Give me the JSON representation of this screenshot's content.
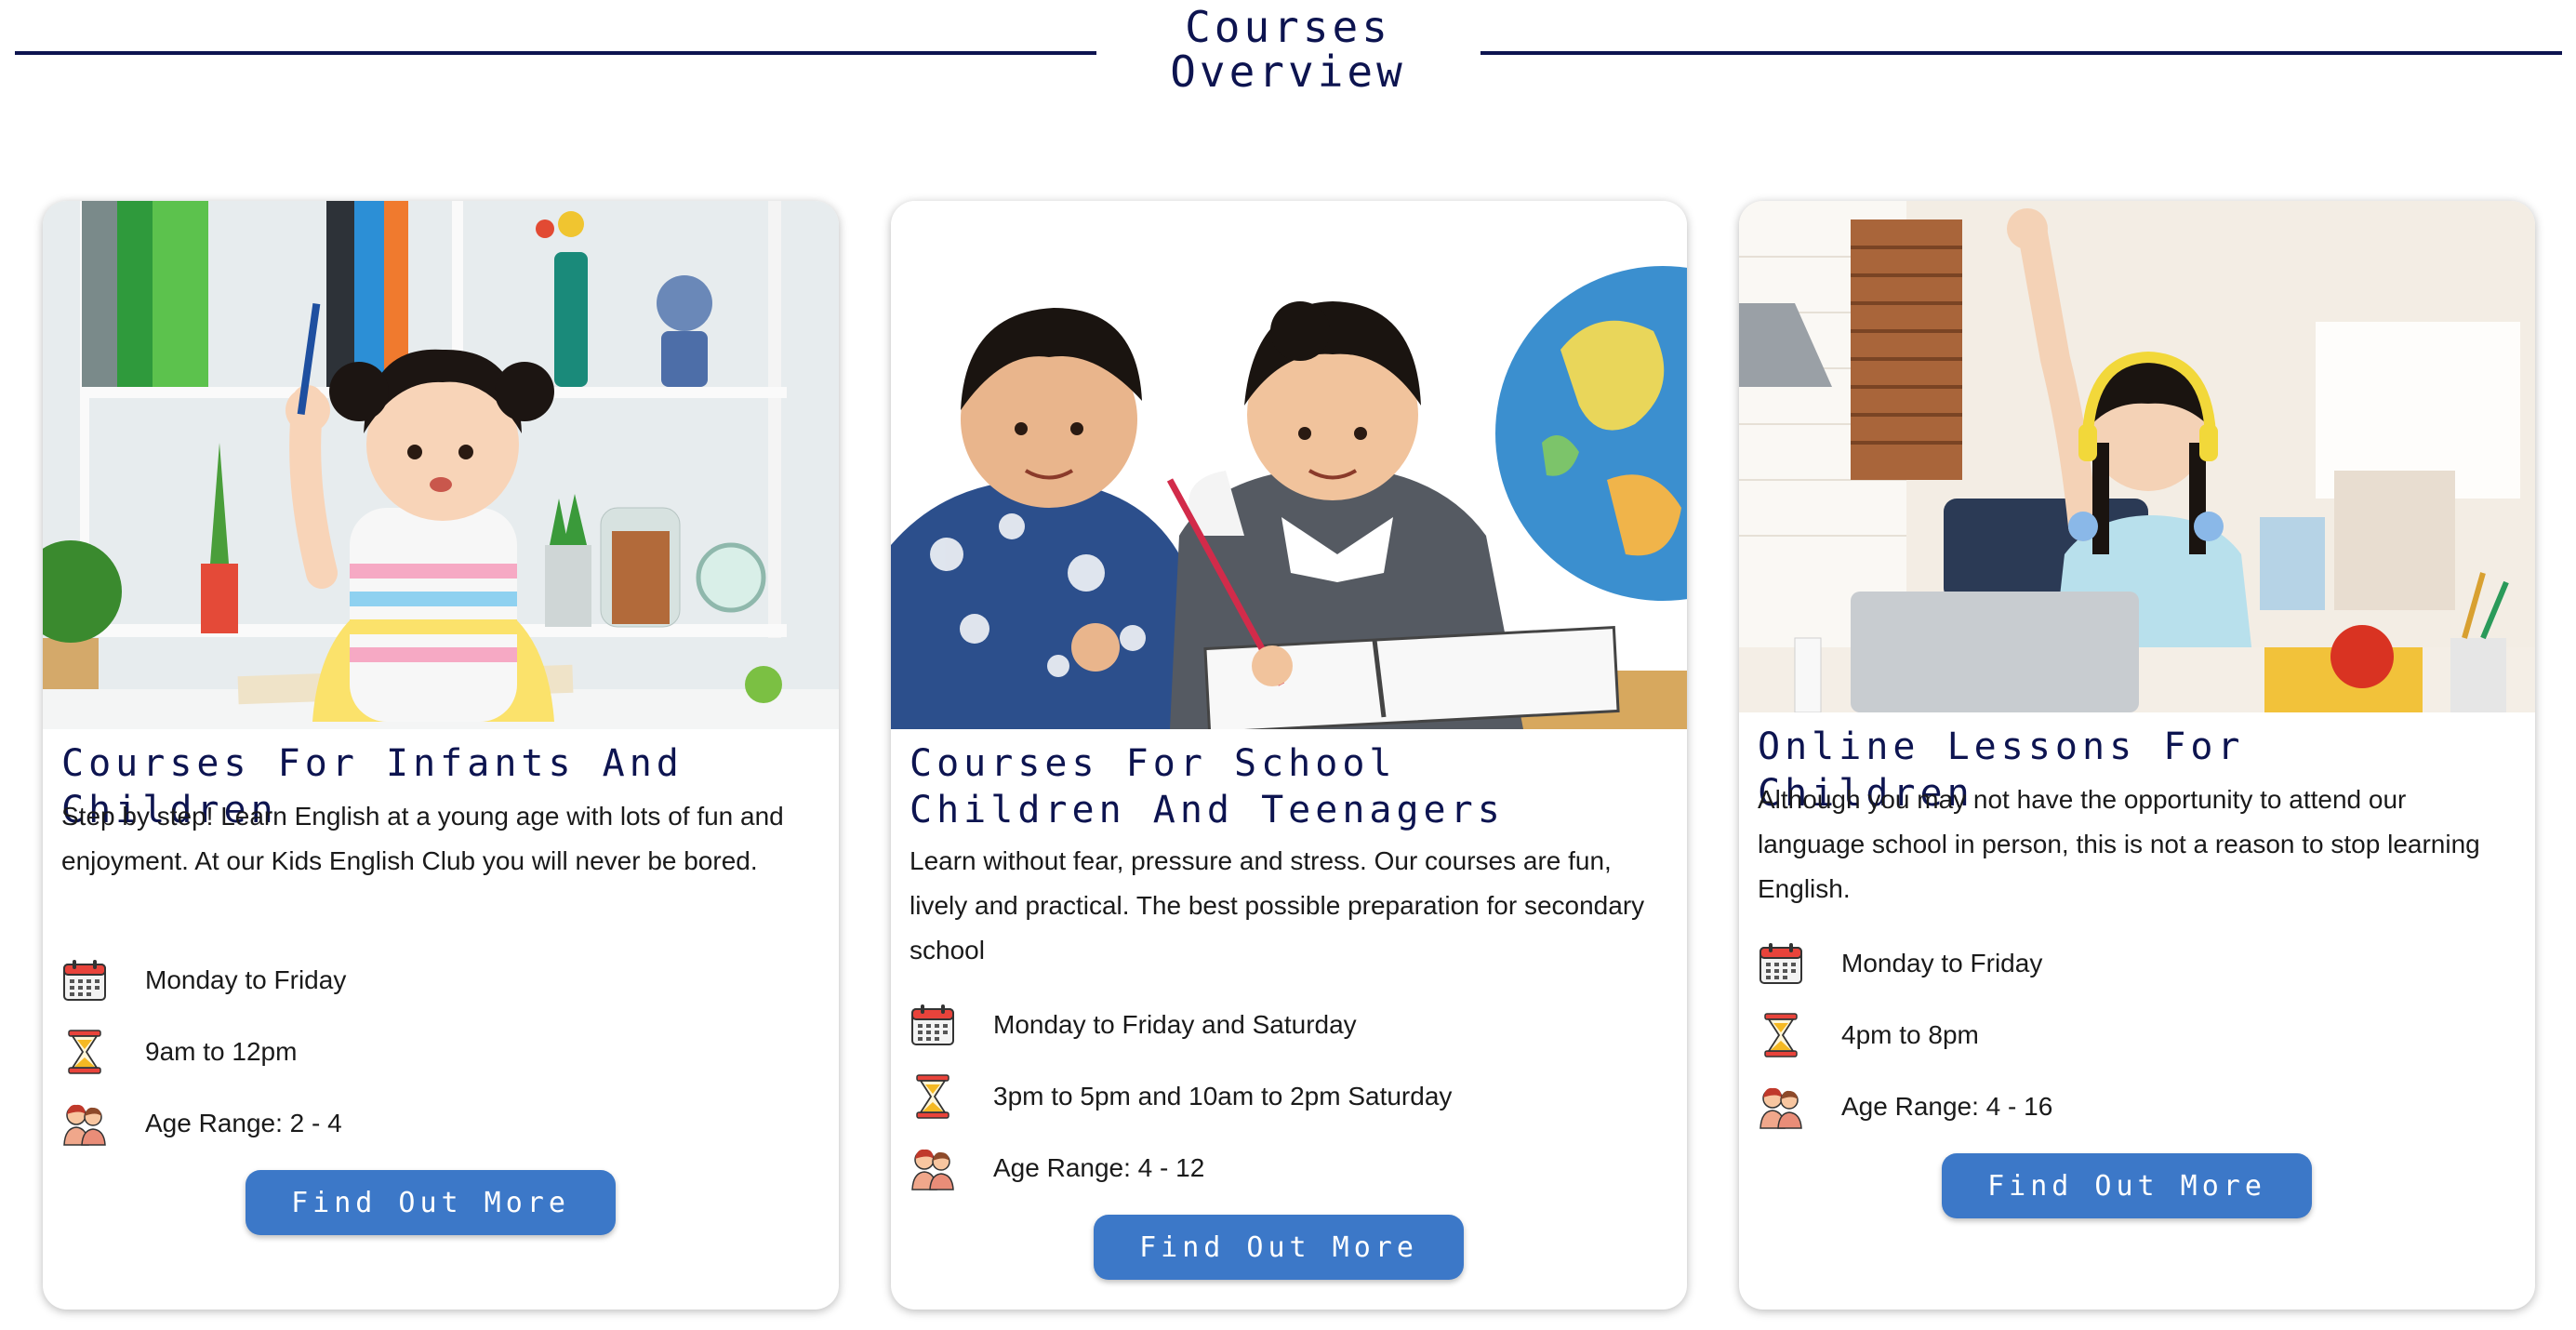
{
  "section": {
    "title": "Courses\nOverview"
  },
  "colors": {
    "navy": "#0d1450",
    "button": "#3c78c8",
    "text": "#1a1a1a"
  },
  "icons": {
    "schedule": "calendar-icon",
    "time": "hourglass-icon",
    "age": "children-icon"
  },
  "cards": [
    {
      "title": "Courses For Infants And Children",
      "description": "Step by step! Learn English at a young age with lots of fun and enjoyment. At our Kids English Club you will never be bored.",
      "days": "Monday to Friday",
      "time": "9am to 12pm",
      "age": "Age Range: 2 - 4",
      "button": "Find Out More",
      "image": "toddler girl with raised pencil by bookshelf"
    },
    {
      "title": "Courses For School Children And Teenagers",
      "description": "Learn without fear, pressure and stress. Our courses are fun, lively and practical. The best possible preparation for secondary school",
      "days": "Monday to Friday and Saturday",
      "time": "3pm to 5pm and 10am to 2pm Saturday",
      "age": "Age Range: 4 - 12",
      "button": "Find Out More",
      "image": "boy and girl writing in notebook beside globe"
    },
    {
      "title": "Online Lessons For Children",
      "description": "Although you may not have the opportunity to attend our language school in person, this is not a reason to stop learning English.",
      "days": "Monday to Friday",
      "time": "4pm to 8pm",
      "age": "Age Range: 4 - 16",
      "button": "Find Out More",
      "image": "girl with headphones raising hand at laptop"
    }
  ]
}
